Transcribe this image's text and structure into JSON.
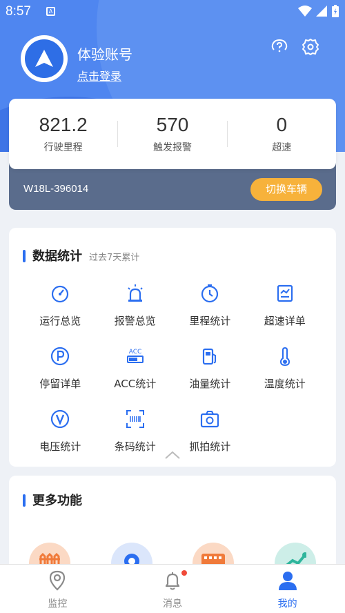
{
  "status_bar": {
    "time": "8:57"
  },
  "profile": {
    "name": "体验账号",
    "login_link": "点击登录"
  },
  "stats": [
    {
      "value": "821.2",
      "label": "行驶里程"
    },
    {
      "value": "570",
      "label": "触发报警"
    },
    {
      "value": "0",
      "label": "超速"
    }
  ],
  "vehicle": {
    "plate": "W18L-396014",
    "switch_label": "切换车辆"
  },
  "data_section": {
    "title": "数据统计",
    "subtitle": "过去7天累计",
    "items": [
      {
        "label": "运行总览",
        "icon": "gauge-icon"
      },
      {
        "label": "报警总览",
        "icon": "alarm-light-icon"
      },
      {
        "label": "里程统计",
        "icon": "clock-timer-icon"
      },
      {
        "label": "超速详单",
        "icon": "chart-document-icon"
      },
      {
        "label": "停留详单",
        "icon": "parking-icon"
      },
      {
        "label": "ACC统计",
        "icon": "acc-icon"
      },
      {
        "label": "油量统计",
        "icon": "fuel-pump-icon"
      },
      {
        "label": "温度统计",
        "icon": "thermometer-icon"
      },
      {
        "label": "电压统计",
        "icon": "voltage-icon"
      },
      {
        "label": "条码统计",
        "icon": "barcode-scan-icon"
      },
      {
        "label": "抓拍统计",
        "icon": "camera-icon"
      }
    ]
  },
  "more_section": {
    "title": "更多功能"
  },
  "tabs": [
    {
      "label": "监控",
      "icon": "location-pin-icon"
    },
    {
      "label": "消息",
      "icon": "bell-icon"
    },
    {
      "label": "我的",
      "icon": "person-icon"
    }
  ],
  "colors": {
    "primary": "#2b6ef0",
    "accent": "#f7b23b",
    "vehicle_bar": "#5a6c8c"
  }
}
